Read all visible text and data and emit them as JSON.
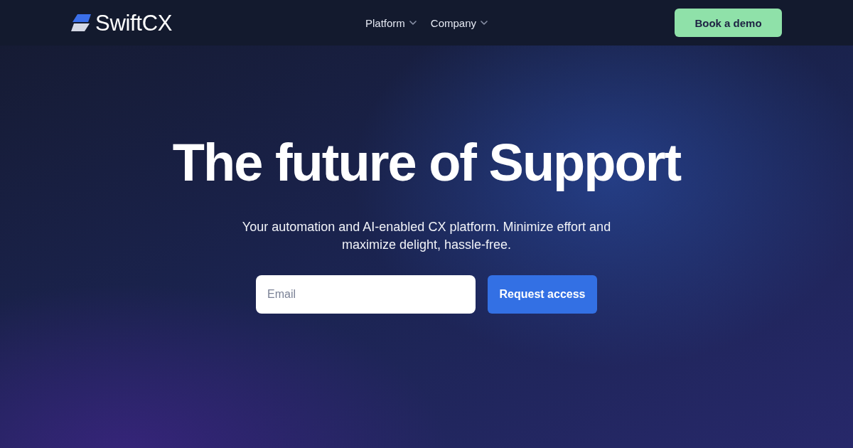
{
  "header": {
    "logo": {
      "text": "SwiftCX"
    },
    "nav": [
      {
        "label": "Platform"
      },
      {
        "label": "Company"
      }
    ],
    "cta": "Book a demo"
  },
  "hero": {
    "title": "The future of Support",
    "subtitle": "Your automation and AI-enabled CX platform. Minimize effort and maximize delight, hassle-free.",
    "email": {
      "placeholder": "Email"
    },
    "submit": "Request access"
  }
}
